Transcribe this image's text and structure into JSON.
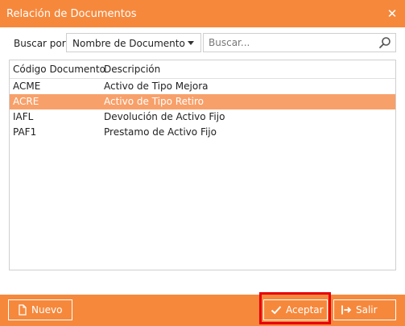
{
  "window": {
    "title": "Relación de Documentos"
  },
  "search": {
    "label": "Buscar por:",
    "field_selected": "Nombre de Documento",
    "placeholder": "Buscar..."
  },
  "grid": {
    "columns": [
      "Código Documento",
      "Descripción"
    ],
    "rows": [
      {
        "code": "ACME",
        "description": "Activo de Tipo Mejora",
        "selected": false
      },
      {
        "code": "ACRE",
        "description": "Activo de Tipo Retiro",
        "selected": true
      },
      {
        "code": "IAFL",
        "description": "Devolución de Activo Fijo",
        "selected": false
      },
      {
        "code": "PAF1",
        "description": "Prestamo de Activo Fijo",
        "selected": false
      }
    ]
  },
  "footer": {
    "new_label": "Nuevo",
    "accept_label": "Aceptar",
    "exit_label": "Salir"
  },
  "colors": {
    "accent": "#f6883c",
    "selected_row": "#f8a06a",
    "highlight_border": "#e8000b"
  }
}
